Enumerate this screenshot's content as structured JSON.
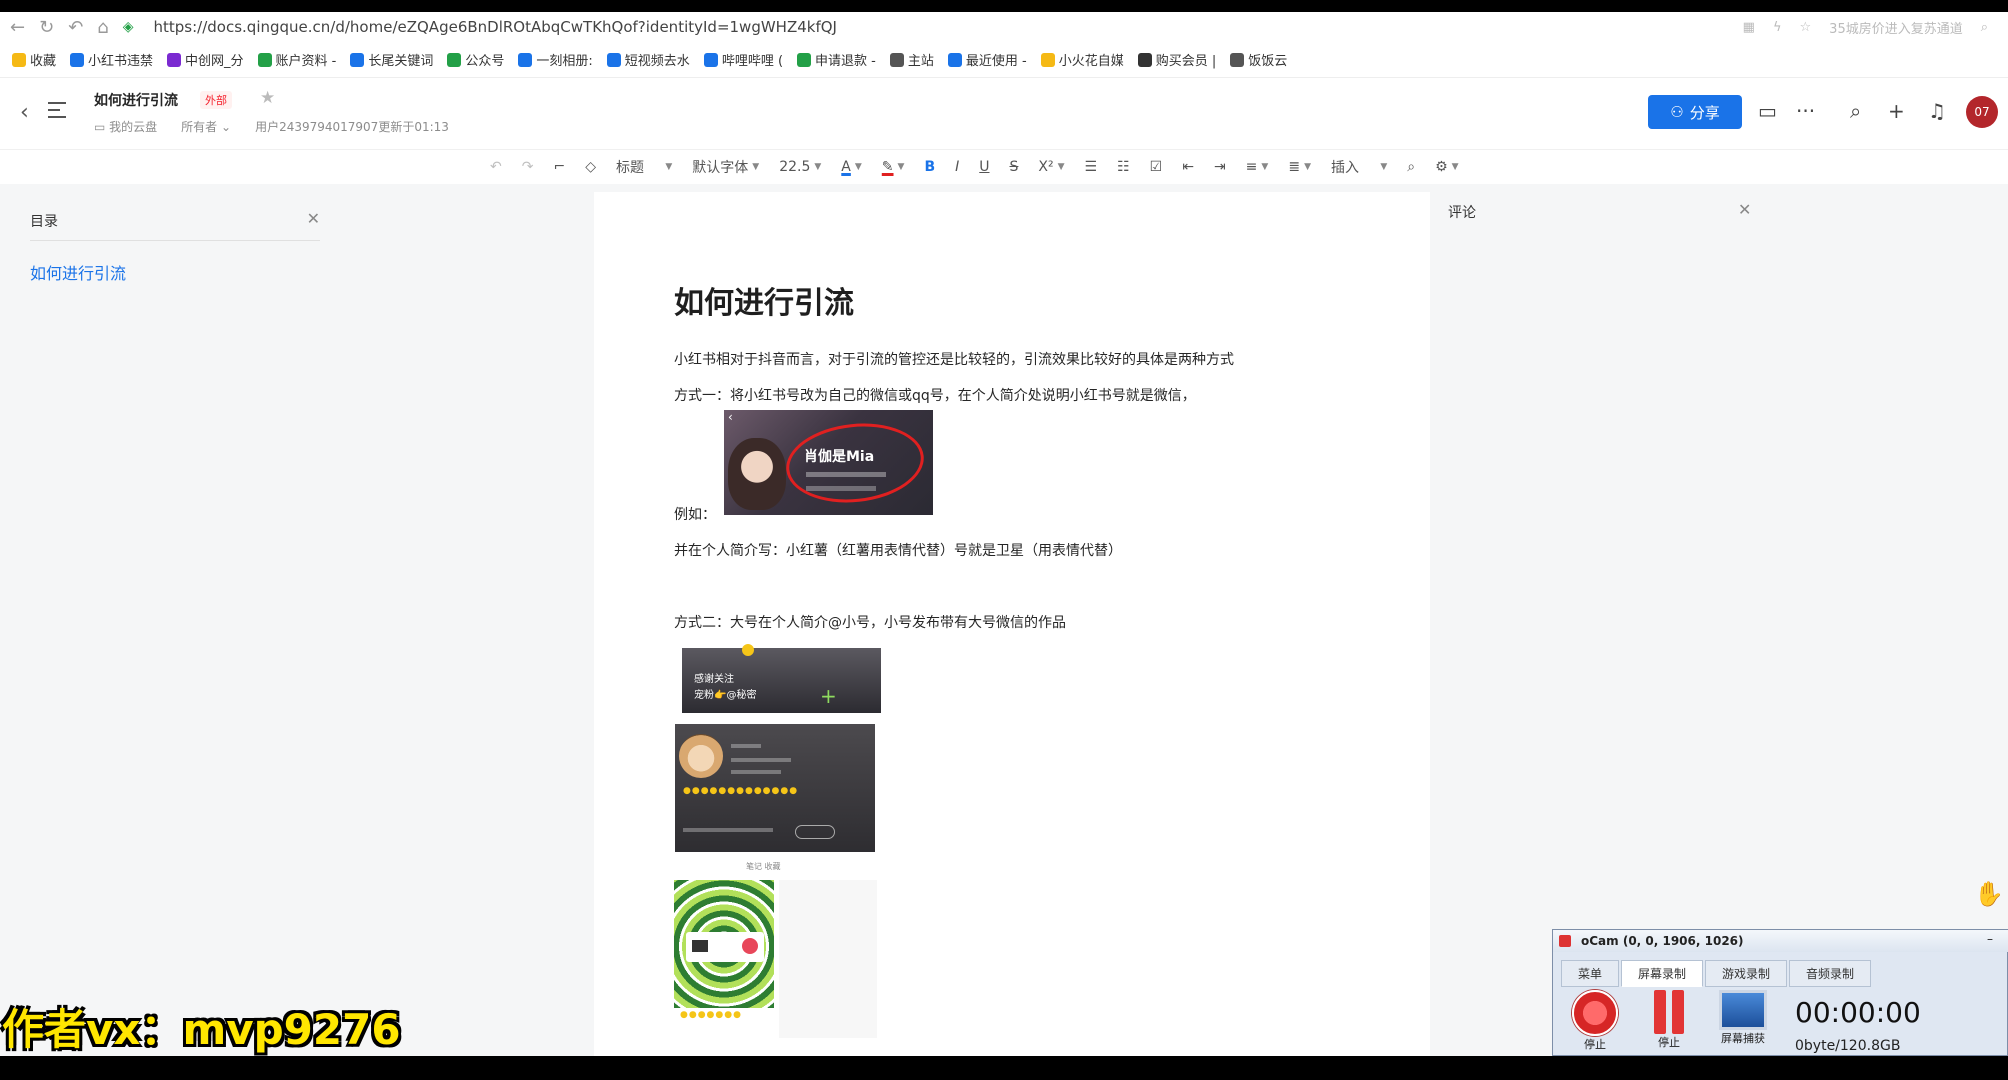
{
  "browser": {
    "url": "https://docs.qingque.cn/d/home/eZQAge6BnDlROtAbqCwTKhQof?identityId=1wgWHZ4kfQJ",
    "right_hint": "35城房价进入复苏通道"
  },
  "bookmarks": [
    {
      "label": "收藏",
      "color": "#f5b915"
    },
    {
      "label": "小红书违禁",
      "color": "#1a73e8"
    },
    {
      "label": "中创网_分",
      "color": "#7b2ad1"
    },
    {
      "label": "账户资料 -",
      "color": "#23a047"
    },
    {
      "label": "长尾关键词",
      "color": "#1a73e8"
    },
    {
      "label": "公众号",
      "color": "#23a047"
    },
    {
      "label": "一刻相册:",
      "color": "#1a73e8"
    },
    {
      "label": "短视频去水",
      "color": "#1a73e8"
    },
    {
      "label": "哔哩哔哩 (",
      "color": "#1a73e8"
    },
    {
      "label": "申请退款 -",
      "color": "#23a047"
    },
    {
      "label": "主站",
      "color": "#555555"
    },
    {
      "label": "最近使用 -",
      "color": "#1a73e8"
    },
    {
      "label": "小火花自媒",
      "color": "#f5b915"
    },
    {
      "label": "购买会员 |",
      "color": "#333333"
    },
    {
      "label": "饭饭云",
      "color": "#555555"
    }
  ],
  "header": {
    "title": "如何进行引流",
    "badge": "外部",
    "location": "我的云盘",
    "permission": "所有者",
    "updated": "用户2439794017907更新于01:13",
    "share_label": "分享",
    "avatar_text": "07"
  },
  "toolbar": {
    "heading": "标题",
    "font": "默认字体",
    "size": "22.5",
    "insert": "插入"
  },
  "toc": {
    "title": "目录",
    "items": [
      "如何进行引流"
    ]
  },
  "doc": {
    "h1": "如何进行引流",
    "p1": "小红书相对于抖音而言，对于引流的管控还是比较轻的，引流效果比较好的具体是两种方式",
    "p2": "方式一：将小红书号改为自己的微信或qq号，在个人简介处说明小红书号就是微信，",
    "p3": "例如：",
    "p4": "并在个人简介写：小红薯（红薯用表情代替）号就是卫星（用表情代替）",
    "p5": "方式二：大号在个人简介@小号，小号发布带有大号微信的作品",
    "img1_name": "肖伽是Mia",
    "img2_line1": "感谢关注",
    "img2_line2": "宠粉👉@秘密",
    "img3_tabs": "笔记   收藏"
  },
  "comments": {
    "title": "评论"
  },
  "ocam": {
    "title": "oCam (0, 0, 1906, 1026)",
    "tabs": [
      "菜单",
      "屏幕录制",
      "游戏录制",
      "音频录制"
    ],
    "btn_stop": "停止",
    "btn_pause": "停止",
    "btn_capture": "屏幕捕获",
    "time": "00:00:00",
    "bytes": "0byte/120.8GB"
  },
  "watermark": "作者vx：mvp9276"
}
